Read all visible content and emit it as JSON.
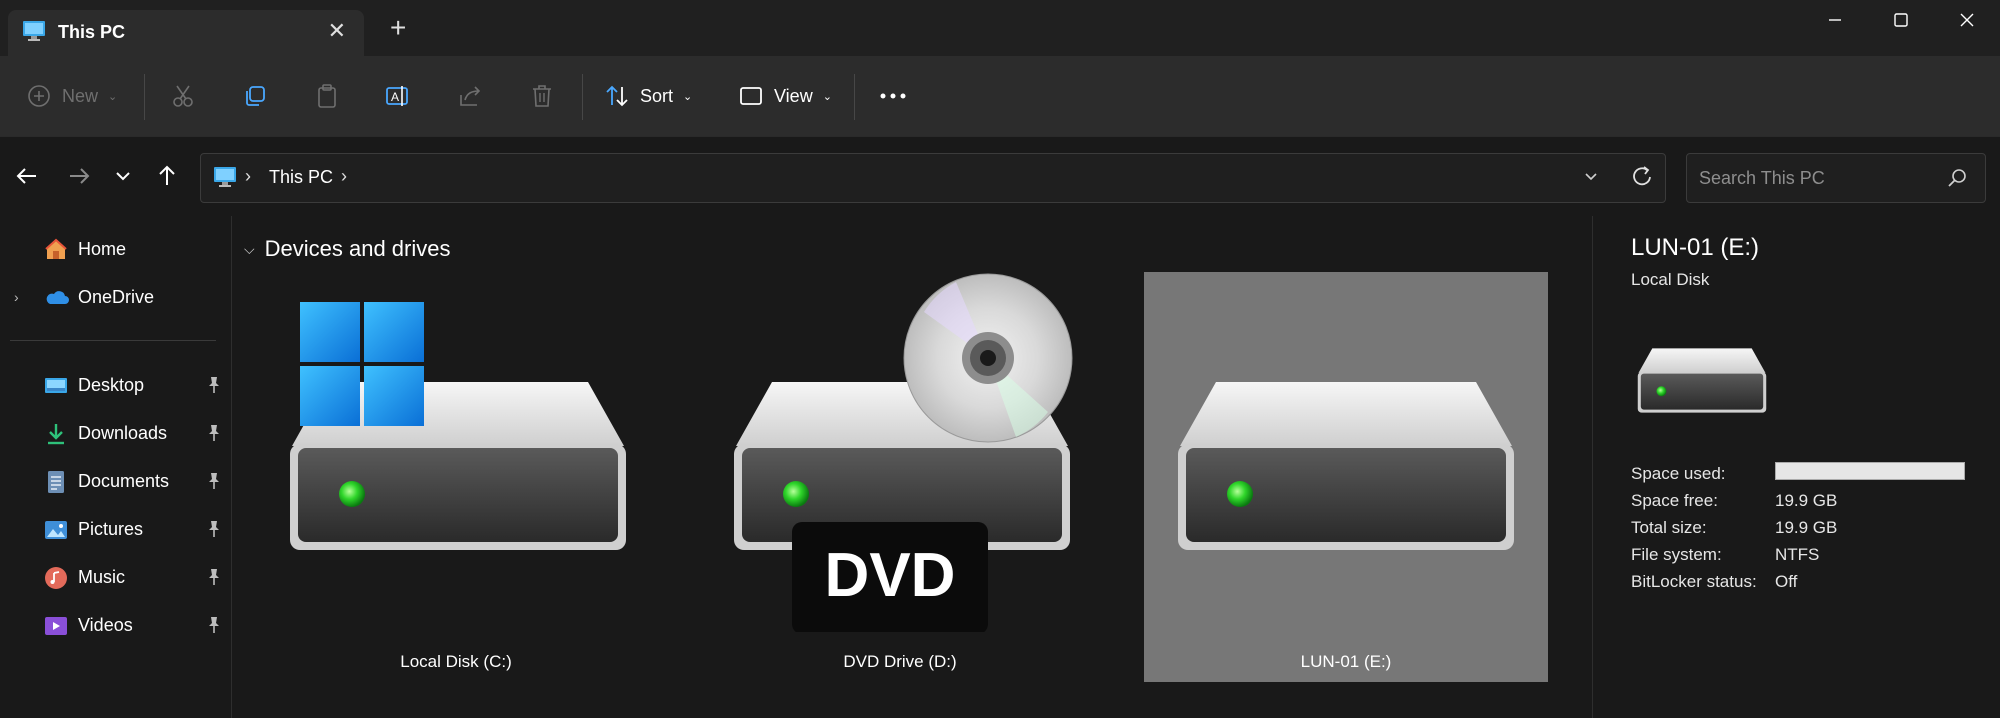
{
  "window": {
    "tab_title": "This PC",
    "tab_icon": "this-pc-icon",
    "new_tab_label": "+",
    "controls": {
      "minimize": "minimize-icon",
      "maximize": "maximize-icon",
      "close": "close-icon"
    }
  },
  "commandbar": {
    "new_label": "New",
    "sort_label": "Sort",
    "view_label": "View",
    "more_icon": "more-icon",
    "disabled_color": "#6f6f6f"
  },
  "navigation": {
    "back_icon": "back-arrow-icon",
    "forward_icon": "forward-arrow-icon",
    "recent_icon": "chevron-down-icon",
    "up_icon": "up-arrow-icon",
    "breadcrumb": [
      "This PC"
    ],
    "search_placeholder": "Search This PC"
  },
  "sidebar": {
    "top_items": [
      {
        "label": "Home",
        "icon": "home-icon"
      },
      {
        "label": "OneDrive",
        "icon": "onedrive-cloud-icon",
        "expandable": true
      }
    ],
    "quick_access": [
      {
        "label": "Desktop",
        "icon": "desktop-folder-icon",
        "pinned": true
      },
      {
        "label": "Downloads",
        "icon": "downloads-icon",
        "pinned": true
      },
      {
        "label": "Documents",
        "icon": "documents-icon",
        "pinned": true
      },
      {
        "label": "Pictures",
        "icon": "pictures-icon",
        "pinned": true
      },
      {
        "label": "Music",
        "icon": "music-icon",
        "pinned": true
      },
      {
        "label": "Videos",
        "icon": "videos-icon",
        "pinned": true
      }
    ]
  },
  "main": {
    "group_title": "Devices and drives",
    "drives": [
      {
        "name": "Local Disk (C:)",
        "icon": "windows-system-drive-icon",
        "selected": false
      },
      {
        "name": "DVD Drive (D:)",
        "icon": "dvd-drive-icon",
        "badge": "DVD",
        "selected": false
      },
      {
        "name": "LUN-01 (E:)",
        "icon": "hard-drive-icon",
        "selected": true
      }
    ],
    "selection_color": "#777777"
  },
  "details": {
    "title": "LUN-01 (E:)",
    "subtitle": "Local Disk",
    "icon": "hard-drive-icon",
    "properties": [
      {
        "label": "Space used:",
        "value": ""
      },
      {
        "label": "Space free:",
        "value": "19.9 GB"
      },
      {
        "label": "Total size:",
        "value": "19.9 GB"
      },
      {
        "label": "File system:",
        "value": "NTFS"
      },
      {
        "label": "BitLocker status:",
        "value": "Off"
      }
    ],
    "space_used_fraction": 1.0
  }
}
